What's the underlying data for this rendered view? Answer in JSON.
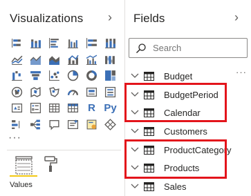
{
  "visualizations": {
    "title": "Visualizations",
    "collapse_glyph": "›",
    "more_glyph": "···",
    "text_icons": {
      "r": "R",
      "py": "Py"
    },
    "values_label": "Values",
    "icons": [
      "stacked-bar-chart-icon",
      "stacked-column-chart-icon",
      "clustered-bar-chart-icon",
      "clustered-column-chart-icon",
      "100-stacked-bar-chart-icon",
      "100-stacked-column-chart-icon",
      "line-chart-icon",
      "area-chart-icon",
      "stacked-area-chart-icon",
      "line-and-column-chart-icon",
      "line-and-clustered-column-chart-icon",
      "ribbon-chart-icon",
      "waterfall-chart-icon",
      "funnel-icon",
      "scatter-chart-icon",
      "pie-chart-icon",
      "donut-chart-icon",
      "treemap-icon",
      "map-icon",
      "filled-map-icon",
      "shape-map-icon",
      "gauge-icon",
      "card-icon",
      "multi-row-card-icon",
      "kpi-icon",
      "slicer-icon",
      "table-icon",
      "matrix-icon",
      "r-script-icon",
      "python-icon",
      "key-influencers-icon",
      "decomposition-tree-icon",
      "qa-icon",
      "smart-narrative-icon",
      "paginated-report-icon",
      "arcgis-icon"
    ]
  },
  "fields": {
    "title": "Fields",
    "collapse_glyph": "›",
    "search_placeholder": "Search",
    "more_options_glyph": "···",
    "tables": [
      {
        "label": "Budget"
      },
      {
        "label": "BudgetPeriod"
      },
      {
        "label": "Calendar"
      },
      {
        "label": "Customers"
      },
      {
        "label": "ProductCategory"
      },
      {
        "label": "Products"
      },
      {
        "label": "Sales"
      }
    ]
  },
  "colors": {
    "highlight": "#e3141b",
    "accent_yellow": "#f2c811",
    "icon_blue": "#3b6fb6",
    "icon_gray": "#605e5c"
  }
}
